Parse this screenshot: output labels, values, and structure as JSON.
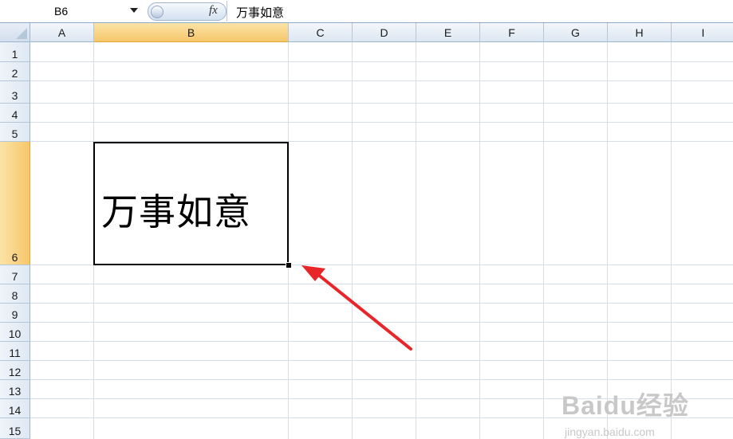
{
  "formula_bar": {
    "name_box": "B6",
    "fx_label": "fx",
    "content": "万事如意"
  },
  "columns": [
    "A",
    "B",
    "C",
    "D",
    "E",
    "F",
    "G",
    "H",
    "I"
  ],
  "selected_column": "B",
  "rows": [
    "1",
    "2",
    "3",
    "4",
    "5",
    "6",
    "7",
    "8",
    "9",
    "10",
    "11",
    "12",
    "13",
    "14",
    "15"
  ],
  "selected_row": "6",
  "cells": {
    "B6": "万事如意"
  },
  "annotation": {
    "arrow_color": "#e8262a"
  },
  "watermark": {
    "brand": "Baidu经验",
    "url": "jingyan.baidu.com"
  }
}
